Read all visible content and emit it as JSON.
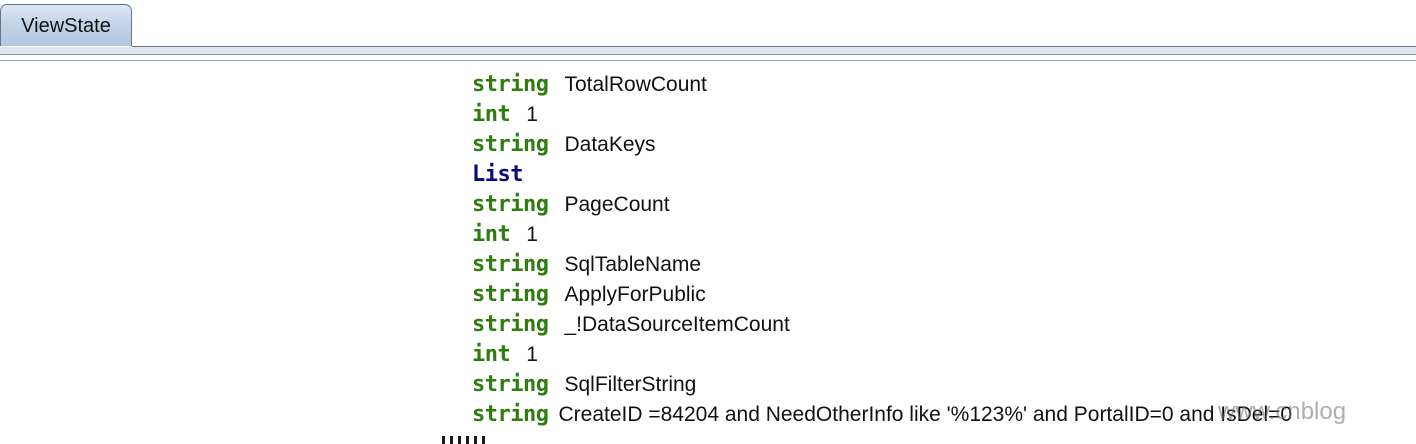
{
  "tabs": [
    {
      "label": "ViewState",
      "active": true
    }
  ],
  "entries": [
    {
      "type": "string",
      "value": "TotalRowCount"
    },
    {
      "type": "int",
      "value": "1"
    },
    {
      "type": "string",
      "value": "DataKeys"
    },
    {
      "type": "List",
      "value": ""
    },
    {
      "type": "string",
      "value": "PageCount"
    },
    {
      "type": "int",
      "value": "1"
    },
    {
      "type": "string",
      "value": "SqlTableName"
    },
    {
      "type": "string",
      "value": "ApplyForPublic"
    },
    {
      "type": "string",
      "value": "_!DataSourceItemCount"
    },
    {
      "type": "int",
      "value": "1"
    },
    {
      "type": "string",
      "value": "SqlFilterString"
    },
    {
      "type": "string",
      "value": " CreateID =84204 and NeedOtherInfo like '%123%' and PortalID=0 and IsDel=0"
    }
  ],
  "watermark": "www.cnblog",
  "colors": {
    "string_type": "#2e7d0f",
    "int_type": "#2e7d0f",
    "list_type": "#0a0a80",
    "tab_fill": "#c3d4e9"
  }
}
